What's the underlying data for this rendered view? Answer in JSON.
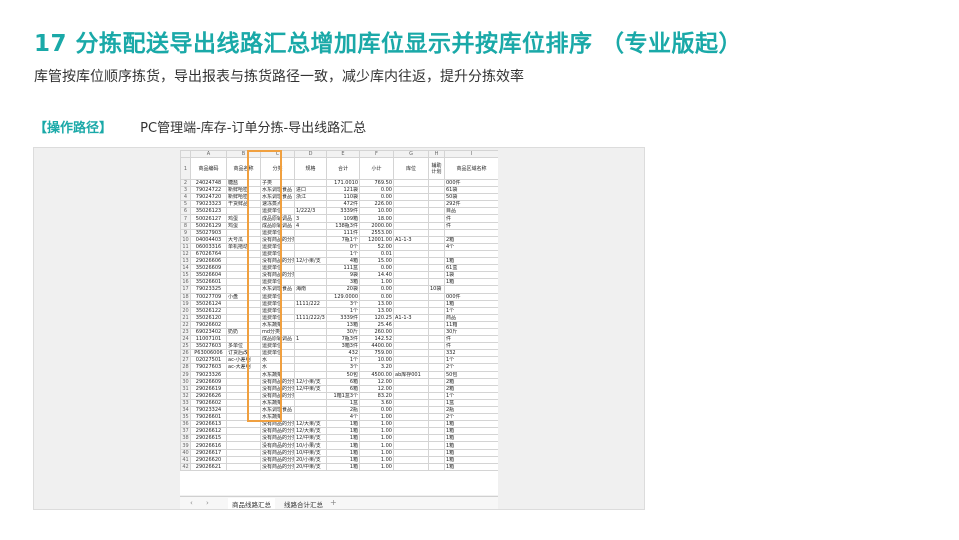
{
  "header": {
    "title": "17  分拣配送导出线路汇总增加库位显示并按库位排序 （专业版起）",
    "subtitle": "库管按库位顺序拣货，导出报表与拣货路径一致，减少库内往返，提升分拣效率",
    "path_label": "【操作路径】",
    "path_value": "PC管理端-库存-订单分拣-导出线路汇总"
  },
  "spreadsheet": {
    "column_letters": [
      "",
      "A",
      "B",
      "C",
      "D",
      "E",
      "F",
      "G",
      "H",
      "I"
    ],
    "header_row": {
      "num": "1",
      "cells": [
        "商品编码",
        "商品名称",
        "分类",
        "规格",
        "合计",
        "小计",
        "库位",
        "辅助计划",
        "商品区域名称"
      ]
    },
    "rows": [
      {
        "n": "2",
        "c": [
          "24024748",
          "糖盐",
          "子类",
          "",
          "171.0010",
          "769.50",
          "",
          "",
          "000件"
        ]
      },
      {
        "n": "3",
        "c": [
          "79024722",
          "新鲜哈密",
          "水东调理食品",
          "进口",
          "121袋",
          "0.00",
          "",
          "",
          "61袋"
        ]
      },
      {
        "n": "4",
        "c": [
          "79024720",
          "新鲜哈密",
          "水东调理食品",
          "浙江",
          "110袋",
          "0.00",
          "",
          "",
          "50袋"
        ]
      },
      {
        "n": "5",
        "c": [
          "79023323",
          "干货鲜品",
          "速冻蒸点",
          "",
          "472件",
          "226.00",
          "",
          "",
          "292件"
        ]
      },
      {
        "n": "6",
        "c": [
          "35026123",
          "",
          "运费单位",
          "1/222/3",
          "3339件",
          "10.00",
          "",
          "",
          "目品"
        ]
      },
      {
        "n": "7",
        "c": [
          "50026127",
          "鸡蛋",
          "成品原辅调品",
          "3",
          "109箱",
          "18.00",
          "",
          "",
          "件"
        ]
      },
      {
        "n": "8",
        "c": [
          "50026129",
          "鸡蛋",
          "成品原辅调品",
          "4",
          "138瓶3件",
          "2000.00",
          "",
          "",
          "件"
        ]
      },
      {
        "n": "9",
        "c": [
          "35027903",
          "",
          "运费单位",
          "",
          "111件",
          "2553.00",
          "",
          "",
          ""
        ]
      },
      {
        "n": "10",
        "c": [
          "04004403",
          "大号瓜",
          "没有商品的分类",
          "",
          "7瓶1个",
          "12001.00",
          "A1-1-3",
          "",
          "2箱"
        ]
      },
      {
        "n": "11",
        "c": [
          "06003316",
          "单机拖动",
          "运费单位",
          "",
          "0个",
          "52.00",
          "",
          "",
          "4个"
        ]
      },
      {
        "n": "12",
        "c": [
          "67026764",
          "",
          "运费单位",
          "",
          "1个",
          "0.01",
          "",
          "",
          ""
        ]
      },
      {
        "n": "13",
        "c": [
          "29026606",
          "",
          "没有商品的分类",
          "12/小果/支",
          "4箱",
          "15.00",
          "",
          "",
          "1箱"
        ]
      },
      {
        "n": "14",
        "c": [
          "35026609",
          "",
          "运费单位",
          "",
          "111盒",
          "0.00",
          "",
          "",
          "61盒"
        ]
      },
      {
        "n": "15",
        "c": [
          "35026604",
          "",
          "没有商品的分类",
          "",
          "9袋",
          "14.40",
          "",
          "",
          "1袋"
        ]
      },
      {
        "n": "16",
        "c": [
          "35026601",
          "",
          "运费单位",
          "",
          "3箱",
          "1.00",
          "",
          "",
          "1箱"
        ]
      },
      {
        "n": "17",
        "c": [
          "79023325",
          "",
          "水东调理食品",
          "海南",
          "20袋",
          "0.00",
          "",
          "10袋",
          ""
        ]
      },
      {
        "n": "18",
        "c": [
          "70027709",
          "小盘",
          "运费单位",
          "",
          "129.0000",
          "0.00",
          "",
          "",
          "000件"
        ]
      },
      {
        "n": "19",
        "c": [
          "35026124",
          "",
          "运费单位",
          "1111/222",
          "3个",
          "13.00",
          "",
          "",
          "1箱"
        ]
      },
      {
        "n": "20",
        "c": [
          "35026122",
          "",
          "运费单位",
          "",
          "1个",
          "13.00",
          "",
          "",
          "1个"
        ]
      },
      {
        "n": "21",
        "c": [
          "35026120",
          "",
          "运费单位",
          "1111/222/3",
          "3339件",
          "120.25",
          "A1-1-3",
          "",
          "商品"
        ]
      },
      {
        "n": "22",
        "c": [
          "79026602",
          "",
          "水东蔬菜",
          "",
          "13箱",
          "25.46",
          "",
          "",
          "11箱"
        ]
      },
      {
        "n": "23",
        "c": [
          "69023402",
          "奶奶",
          "md分类",
          "",
          "30斤",
          "260.00",
          "",
          "",
          "30斤"
        ]
      },
      {
        "n": "24",
        "c": [
          "11007101",
          "",
          "成品原辅调品",
          "1",
          "7瓶3件",
          "142.52",
          "",
          "",
          "件"
        ]
      },
      {
        "n": "25",
        "c": [
          "35027603",
          "多单位",
          "运费单位",
          "",
          "3箱3件",
          "4400.00",
          "",
          "",
          "件"
        ]
      },
      {
        "n": "26",
        "c": [
          "P63006006",
          "订货后改",
          "运费单位",
          "",
          "432",
          "759.00",
          "",
          "",
          "332"
        ]
      },
      {
        "n": "27",
        "c": [
          "02027501",
          "ac-小差明",
          "水",
          "",
          "1个",
          "10.00",
          "",
          "",
          "1个"
        ]
      },
      {
        "n": "28",
        "c": [
          "79027603",
          "ac-大差明",
          "水",
          "",
          "3个",
          "3.20",
          "",
          "",
          "2个"
        ]
      },
      {
        "n": "29",
        "c": [
          "79023326",
          "",
          "水东蔬菜",
          "",
          "50包",
          "4500.00",
          "ab库存001",
          "",
          "50包"
        ]
      },
      {
        "n": "30",
        "c": [
          "29026609",
          "",
          "没有商品的分类",
          "12/小果/支",
          "6箱",
          "12.00",
          "",
          "",
          "2箱"
        ]
      },
      {
        "n": "31",
        "c": [
          "29026619",
          "",
          "没有商品的分类",
          "12/中果/支",
          "6箱",
          "12.00",
          "",
          "",
          "2箱"
        ]
      },
      {
        "n": "32",
        "c": [
          "29026626",
          "",
          "没有商品的分类",
          "",
          "1箱1盒3个",
          "83.20",
          "",
          "",
          "1个"
        ]
      },
      {
        "n": "33",
        "c": [
          "79026602",
          "",
          "水东蔬菜",
          "",
          "1盒",
          "3.60",
          "",
          "",
          "1盒"
        ]
      },
      {
        "n": "34",
        "c": [
          "79023324",
          "",
          "水东调理食品",
          "",
          "2瓶",
          "0.00",
          "",
          "",
          "2瓶"
        ]
      },
      {
        "n": "35",
        "c": [
          "79026601",
          "",
          "水东蔬菜",
          "",
          "4个",
          "1.00",
          "",
          "",
          "2个"
        ]
      },
      {
        "n": "36",
        "c": [
          "29026613",
          "",
          "没有商品的分类",
          "12/大果/支",
          "1箱",
          "1.00",
          "",
          "",
          "1箱"
        ]
      },
      {
        "n": "37",
        "c": [
          "29026612",
          "",
          "没有商品的分类",
          "12/大果/支",
          "1箱",
          "1.00",
          "",
          "",
          "1箱"
        ]
      },
      {
        "n": "38",
        "c": [
          "29026615",
          "",
          "没有商品的分类",
          "12/中果/支",
          "1箱",
          "1.00",
          "",
          "",
          "1箱"
        ]
      },
      {
        "n": "39",
        "c": [
          "29026616",
          "",
          "没有商品的分类",
          "10/小果/支",
          "1箱",
          "1.00",
          "",
          "",
          "1箱"
        ]
      },
      {
        "n": "40",
        "c": [
          "29026617",
          "",
          "没有商品的分类",
          "10/中果/支",
          "1箱",
          "1.00",
          "",
          "",
          "1箱"
        ]
      },
      {
        "n": "41",
        "c": [
          "29026620",
          "",
          "没有商品的分类",
          "20/小果/支",
          "1箱",
          "1.00",
          "",
          "",
          "1箱"
        ]
      },
      {
        "n": "42",
        "c": [
          "29026621",
          "",
          "没有商品的分类",
          "20/中果/支",
          "1箱",
          "1.00",
          "",
          "",
          "1箱"
        ]
      }
    ],
    "sheet_tabs": {
      "nav_prev": "‹",
      "nav_next": "›",
      "active": "商品线路汇总",
      "second": "线路合计汇总",
      "add": "+"
    }
  }
}
